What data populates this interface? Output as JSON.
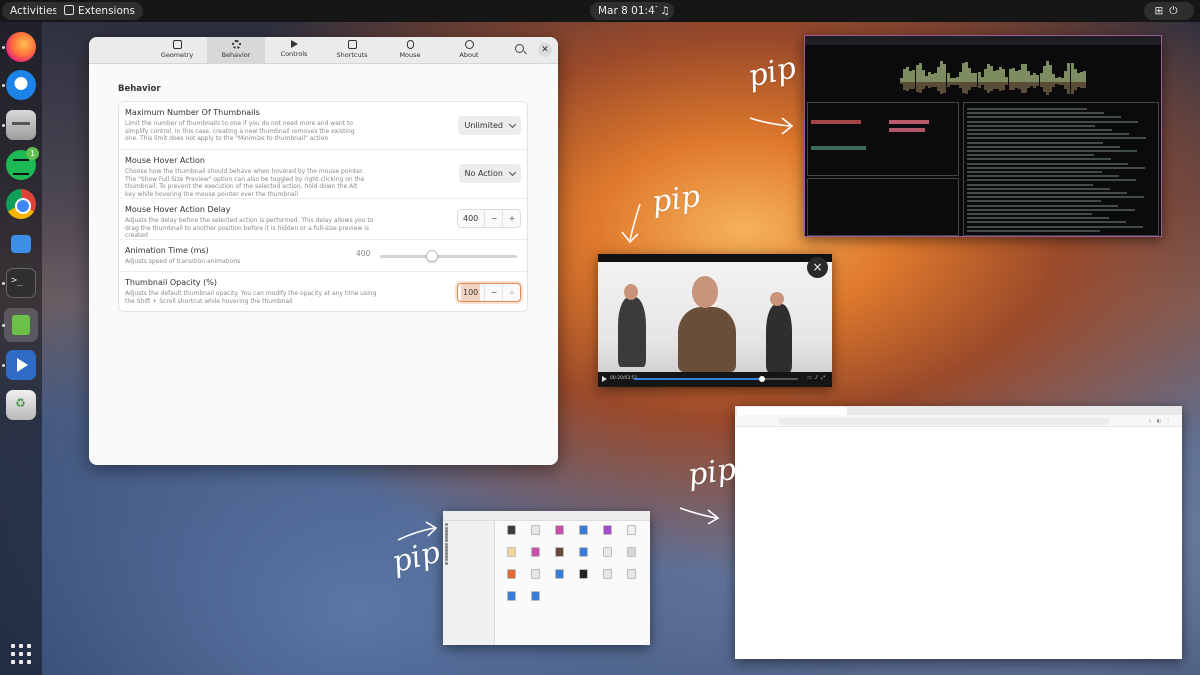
{
  "topbar": {
    "activities": "Activities",
    "extensions": "Extensions",
    "clock": "Mar 8  01:47"
  },
  "dock": {
    "items": [
      {
        "name": "firefox",
        "icon": "firefox-icon"
      },
      {
        "name": "thunderbird",
        "icon": "thunderbird-icon"
      },
      {
        "name": "files",
        "icon": "files-icon"
      },
      {
        "name": "spotify",
        "icon": "spotify-icon",
        "badge": "1"
      },
      {
        "name": "chrome",
        "icon": "chrome-icon"
      },
      {
        "name": "extension-manager",
        "icon": "puzzle-icon"
      },
      {
        "name": "terminal",
        "icon": "terminal-icon"
      },
      {
        "name": "extensions",
        "icon": "extensions-icon"
      },
      {
        "name": "video-editor",
        "icon": "video-editor-icon"
      },
      {
        "name": "trash",
        "icon": "trash-icon"
      }
    ],
    "app_grid_icon": "app-grid-icon"
  },
  "settings": {
    "tabs": [
      {
        "label": "Geometry",
        "icon": "geometry-icon"
      },
      {
        "label": "Behavior",
        "icon": "gear-icon",
        "active": true
      },
      {
        "label": "Controls",
        "icon": "play-icon"
      },
      {
        "label": "Shortcuts",
        "icon": "shortcuts-icon"
      },
      {
        "label": "Mouse",
        "icon": "mouse-icon"
      },
      {
        "label": "About",
        "icon": "info-icon"
      }
    ],
    "section_title": "Behavior",
    "rows": {
      "max_thumbnails": {
        "title": "Maximum Number Of Thumbnails",
        "description": "Limit the number of thumbnails to one if you do not need more and want to simplify control. In this case, creating a new thumbnail removes the existing one. This limit does not apply to the \"Minimize to thumbnail\" action",
        "value": "Unlimited"
      },
      "hover_action": {
        "title": "Mouse Hover Action",
        "description": "Choose how the thumbnail should behave when hovered by the mouse pointer. The \"Show Full Size Preview\" option can also be toggled by right-clicking on the thumbnail. To prevent the execution of the selected action, hold down the Alt key while hovering the mouse pointer over the thumbnail",
        "value": "No Action"
      },
      "hover_delay": {
        "title": "Mouse Hover Action Delay",
        "description": "Adjusts the delay before the selected action is performed. This delay allows you to drag the thumbnail to another position before it is hidden or a full-size preview is created",
        "value": "400",
        "minus": "−",
        "plus": "+"
      },
      "animation_time": {
        "title": "Animation Time (ms)",
        "description": "Adjusts speed of transition animations",
        "value": "400",
        "level_fraction": 0.38
      },
      "opacity": {
        "title": "Thumbnail Opacity (%)",
        "description": "Adjusts the default thumbnail opacity. You can modify the opacity at any time using the Shift + Scroll shortcut while hovering the thumbnail",
        "value": "100",
        "minus": "−",
        "plus": "+"
      }
    },
    "close_icon": "close-icon",
    "search_icon": "search-icon"
  },
  "annotations": [
    "pip",
    "pip",
    "pip",
    "pip"
  ],
  "video_pip": {
    "time": "00:20/03:51",
    "progress_fraction": 0.78,
    "close": "×"
  },
  "accent_color": "#e68a55"
}
